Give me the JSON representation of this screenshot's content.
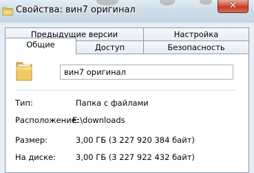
{
  "window": {
    "title": "Свойства: вин7 оригинал",
    "close_symbol": "✕"
  },
  "tabs": {
    "row_top": [
      {
        "label": "Предыдущие версии"
      },
      {
        "label": "Настройка"
      }
    ],
    "row_bottom": [
      {
        "label": "Общие",
        "active": true
      },
      {
        "label": "Доступ"
      },
      {
        "label": "Безопасность"
      }
    ]
  },
  "general": {
    "folder_icon": "folder-icon",
    "name_value": "вин7 оригинал",
    "properties": [
      {
        "label": "Тип:",
        "value": "Папка с файлами"
      },
      {
        "label": "Расположение:",
        "value": "E:\\downloads"
      },
      {
        "label": "Размер:",
        "value": "3,00 ГБ (3 227 920 384 байт)"
      },
      {
        "label": "На диске:",
        "value": "3,00 ГБ (3 227 922 432 байт)"
      }
    ]
  },
  "colors": {
    "close_button": "#c8462f",
    "tab_border": "#8c9aab",
    "folder": "#e8c35a"
  }
}
